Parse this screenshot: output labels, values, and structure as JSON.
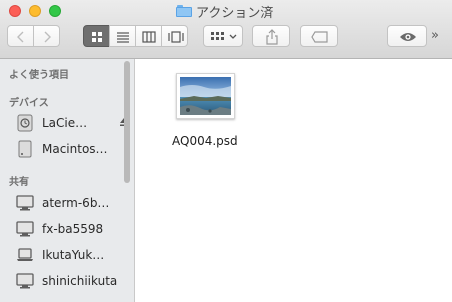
{
  "window": {
    "title": "アクション済"
  },
  "toolbar": {
    "back_icon": "chevron-left-icon",
    "forward_icon": "chevron-right-icon",
    "view_modes": [
      {
        "name": "icon-view",
        "selected": true
      },
      {
        "name": "list-view",
        "selected": false
      },
      {
        "name": "column-view",
        "selected": false
      },
      {
        "name": "cover-flow-view",
        "selected": false
      }
    ],
    "more_label": "»"
  },
  "sidebar": {
    "sections": [
      {
        "header": "よく使う項目",
        "items": []
      },
      {
        "header": "デバイス",
        "items": [
          {
            "label": "LaCie…",
            "icon": "time-machine-drive-icon"
          },
          {
            "label": "Macintos…",
            "icon": "hard-drive-icon"
          }
        ]
      },
      {
        "header": "共有",
        "items": [
          {
            "label": "aterm-6b…",
            "icon": "monitor-icon"
          },
          {
            "label": "fx-ba5598",
            "icon": "monitor-icon"
          },
          {
            "label": "IkutaYuk…",
            "icon": "laptop-icon"
          },
          {
            "label": "shinichiikuta",
            "icon": "monitor-icon"
          }
        ]
      }
    ]
  },
  "files": [
    {
      "name": "AQ004.psd",
      "icon": "image-thumbnail-icon"
    }
  ],
  "colors": {
    "accent_selected": "#6f6f6f",
    "sidebar_bg": "#e8eaec"
  }
}
